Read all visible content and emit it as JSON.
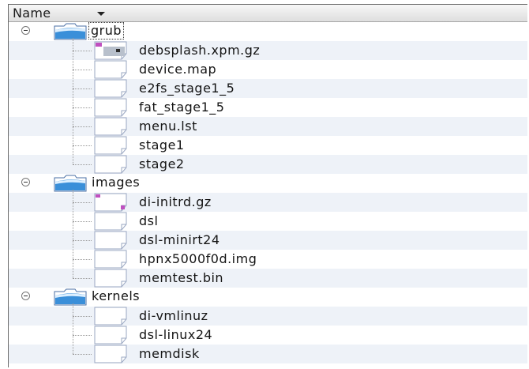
{
  "header": {
    "name_label": "Name"
  },
  "tree": [
    {
      "name": "grub",
      "files": [
        {
          "name": "debsplash.xpm.gz",
          "icon": "image-file-icon"
        },
        {
          "name": "device.map",
          "icon": "file-icon"
        },
        {
          "name": "e2fs_stage1_5",
          "icon": "file-icon"
        },
        {
          "name": "fat_stage1_5",
          "icon": "file-icon"
        },
        {
          "name": "menu.lst",
          "icon": "file-icon"
        },
        {
          "name": "stage1",
          "icon": "file-icon"
        },
        {
          "name": "stage2",
          "icon": "file-icon"
        }
      ]
    },
    {
      "name": "images",
      "files": [
        {
          "name": "di-initrd.gz",
          "icon": "archive-file-icon"
        },
        {
          "name": "dsl",
          "icon": "file-icon"
        },
        {
          "name": "dsl-minirt24",
          "icon": "file-icon"
        },
        {
          "name": "hpnx5000f0d.img",
          "icon": "file-icon"
        },
        {
          "name": "memtest.bin",
          "icon": "file-icon"
        }
      ]
    },
    {
      "name": "kernels",
      "files": [
        {
          "name": "di-vmlinuz",
          "icon": "file-icon"
        },
        {
          "name": "dsl-linux24",
          "icon": "file-icon"
        },
        {
          "name": "memdisk",
          "icon": "file-icon"
        }
      ]
    }
  ],
  "selected_folder": "grub",
  "colors": {
    "row_alt": "#eef2f8",
    "folder_blue": "#3a8fd9",
    "folder_light": "#dcefff",
    "file_border": "#9aa7c2"
  }
}
